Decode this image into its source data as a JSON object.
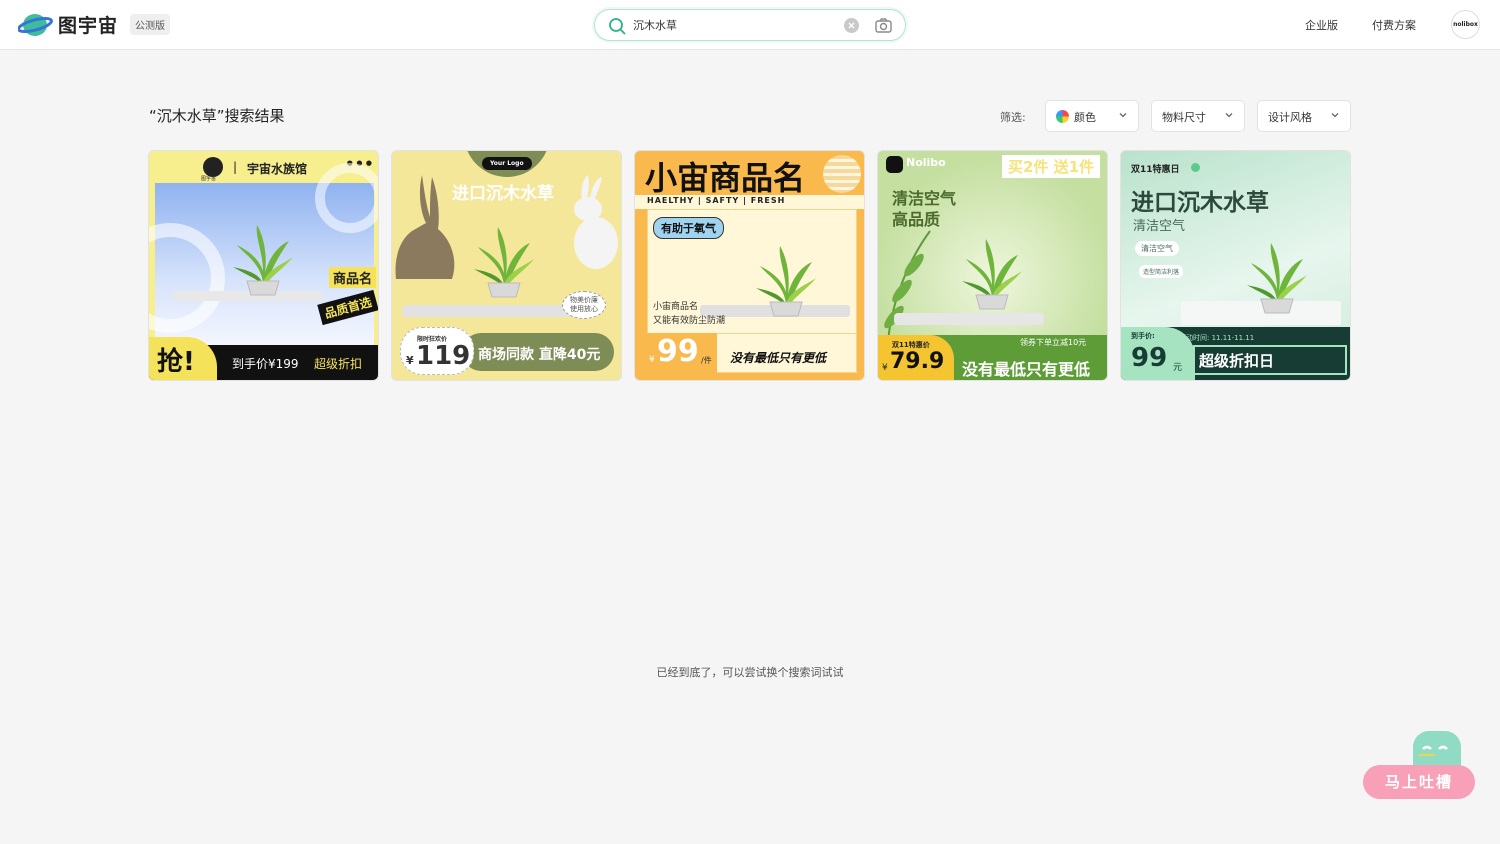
{
  "app": {
    "name": "图宇宙",
    "beta_badge": "公测版"
  },
  "search": {
    "value": "沉木水草"
  },
  "nav": {
    "enterprise": "企业版",
    "pricing": "付费方案",
    "avatar_text": "nolibox"
  },
  "results": {
    "title": "“沉木水草”搜索结果"
  },
  "filters": {
    "label": "筛选:",
    "color": "颜色",
    "size": "物料尺寸",
    "style": "设计风格"
  },
  "cards": [
    {
      "brand": "宇宙水族馆",
      "mini_logo": "图宇宙",
      "tag1": "商品名",
      "tag2": "品质首选",
      "grab": "抢!",
      "price_text": "到手价¥199",
      "discount": "超级折扣",
      "colors": {
        "bg": "#f7ee8e",
        "bar": "#111111",
        "accent": "#f4e25a"
      }
    },
    {
      "logo": "Your Logo",
      "headline": "进口沉木水草",
      "bubble": "物美价廉\n使用放心",
      "limited": "限时狂欢价",
      "currency": "¥",
      "price": "119",
      "slogan": "商场同款 直降40元",
      "colors": {
        "bg": "#f4e79a",
        "bar": "#7e8c55"
      }
    },
    {
      "headline": "小宙商品名",
      "subline": "HAELTHY | SAFTY | FRESH",
      "tag": "有助于氧气",
      "desc1": "小宙商品名",
      "desc2": "又能有效防尘防潮",
      "price": "99",
      "currency": "¥",
      "unit": "/件",
      "slogan": "没有最低只有更低",
      "colors": {
        "bg": "#f9b94d",
        "panel": "#fff7d8"
      }
    },
    {
      "brand": "Nolibo",
      "promo": "买2件 送1件",
      "line1": "清洁空气",
      "line2": "高品质",
      "coupon": "领券下单立减10元",
      "event": "双11特惠价",
      "currency": "¥",
      "price": "79.9",
      "slogan": "没有最低只有更低",
      "colors": {
        "bg": "#c4dfa0",
        "bar": "#5d9c36",
        "price_bg": "#f4c531"
      }
    },
    {
      "event": "双11特惠日",
      "headline": "进口沉木水草",
      "sub": "清洁空气",
      "chip1": "清洁空气",
      "chip2": "造型简洁利落",
      "price_label": "到手价:",
      "activity": "活动时间: 11.11-11.11",
      "price": "99",
      "unit": "元",
      "slogan": "超级折扣日",
      "colors": {
        "bg": "#c7e8d7",
        "bar": "#173c33"
      }
    }
  ],
  "footer": {
    "end_text": "已经到底了，可以尝试换个搜索词试试"
  },
  "feedback": {
    "label": "马上吐槽"
  },
  "theme": {
    "accent": "#2bb38a",
    "search_border": "#b7e1d4"
  }
}
